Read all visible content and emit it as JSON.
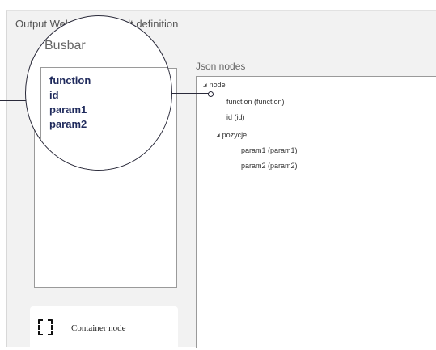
{
  "window": {
    "title": "Output Webservice result definition"
  },
  "busbar_panel": {
    "label": "B",
    "magnified_label": "Busbar",
    "items": [
      "function",
      "id",
      "param1",
      "param2"
    ]
  },
  "json_panel": {
    "label": "Json nodes",
    "tree": [
      {
        "label": "node",
        "toggle": "◢"
      },
      {
        "label": "function (function)"
      },
      {
        "label": "id (id)"
      },
      {
        "label": "pozycje",
        "toggle": "◢"
      },
      {
        "label": "param1 (param1)"
      },
      {
        "label": "param2 (param2)"
      }
    ]
  },
  "container_node": {
    "label": "Container node",
    "icon": "dashed-square-icon"
  }
}
